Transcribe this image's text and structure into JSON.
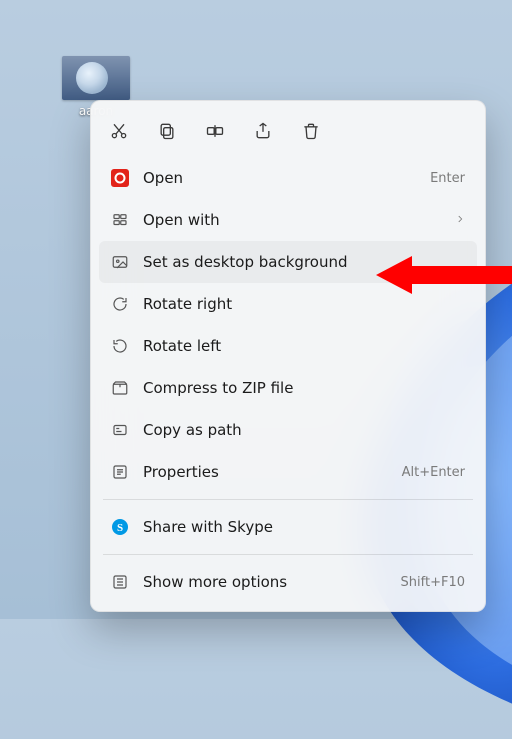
{
  "desktop": {
    "icon_label": "aaron"
  },
  "toolbar": {
    "cut": "cut-icon",
    "copy": "copy-icon",
    "rename": "rename-icon",
    "share": "share-icon",
    "delete": "delete-icon"
  },
  "menu": {
    "open": {
      "label": "Open",
      "shortcut": "Enter"
    },
    "open_with": {
      "label": "Open with"
    },
    "set_bg": {
      "label": "Set as desktop background"
    },
    "rotate_right": {
      "label": "Rotate right"
    },
    "rotate_left": {
      "label": "Rotate left"
    },
    "compress": {
      "label": "Compress to ZIP file"
    },
    "copy_path": {
      "label": "Copy as path"
    },
    "properties": {
      "label": "Properties",
      "shortcut": "Alt+Enter"
    },
    "share_skype": {
      "label": "Share with Skype"
    },
    "show_more": {
      "label": "Show more options",
      "shortcut": "Shift+F10"
    }
  },
  "colors": {
    "skype": "#0099e5",
    "app_red": "#e2231a"
  }
}
